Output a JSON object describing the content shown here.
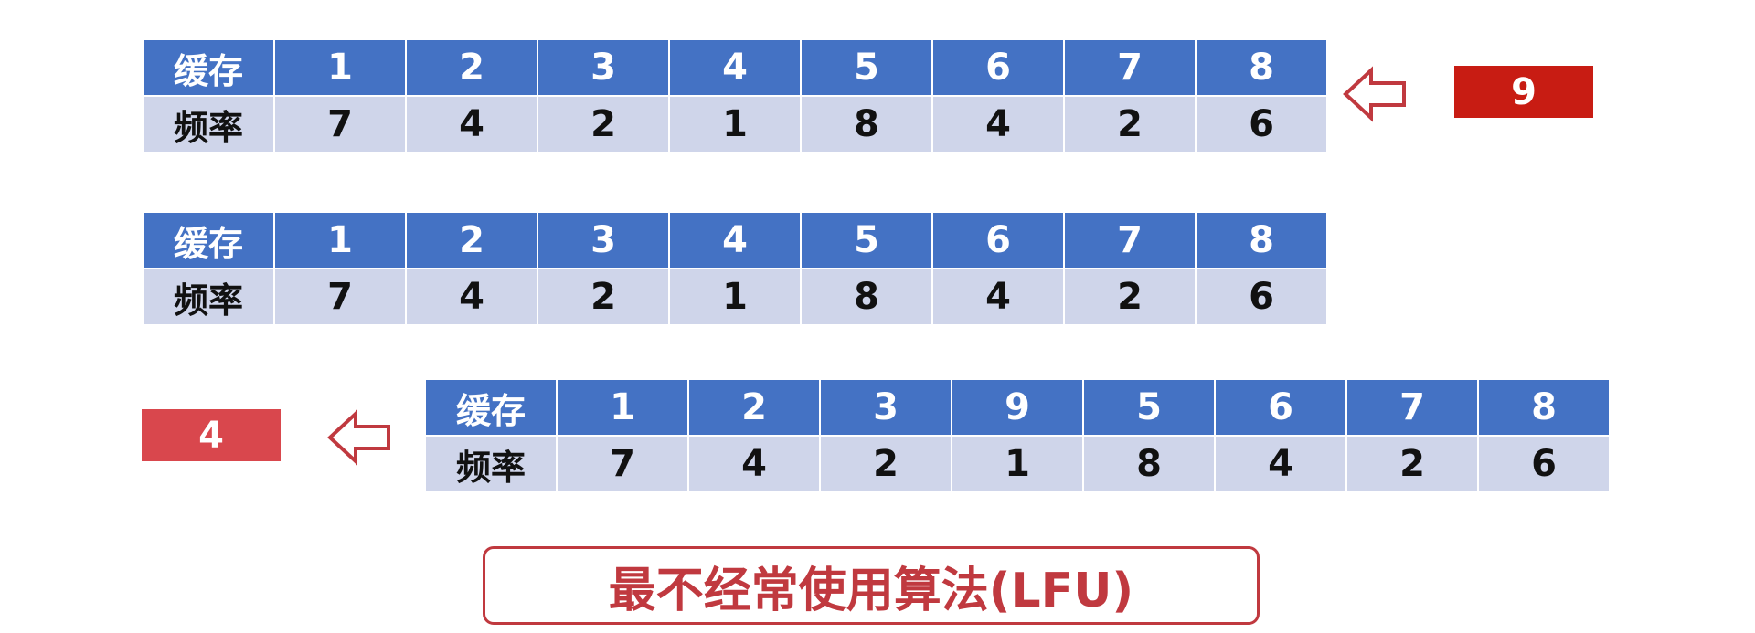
{
  "tables": [
    {
      "cache_label": "缓存",
      "freq_label": "频率",
      "cache": [
        "1",
        "2",
        "3",
        "4",
        "5",
        "6",
        "7",
        "8"
      ],
      "freq": [
        "7",
        "4",
        "2",
        "1",
        "8",
        "4",
        "2",
        "6"
      ]
    },
    {
      "cache_label": "缓存",
      "freq_label": "频率",
      "cache": [
        "1",
        "2",
        "3",
        "4",
        "5",
        "6",
        "7",
        "8"
      ],
      "freq": [
        "7",
        "4",
        "2",
        "1",
        "8",
        "4",
        "2",
        "6"
      ],
      "highlight_index": 3
    },
    {
      "cache_label": "缓存",
      "freq_label": "频率",
      "cache": [
        "1",
        "2",
        "3",
        "9",
        "5",
        "6",
        "7",
        "8"
      ],
      "freq": [
        "7",
        "4",
        "2",
        "1",
        "8",
        "4",
        "2",
        "6"
      ],
      "highlight_index": 3
    }
  ],
  "incoming": "9",
  "evicted": "4",
  "title": "最不经常使用算法(LFU)",
  "colors": {
    "header_bg": "#4472c4",
    "freq_bg": "#cfd5ea",
    "highlight": "#d9474d",
    "incoming_bg": "#c81c13",
    "arrow": "#c0393f"
  },
  "icons": {
    "arrow": "hollow-left-arrow-icon"
  }
}
